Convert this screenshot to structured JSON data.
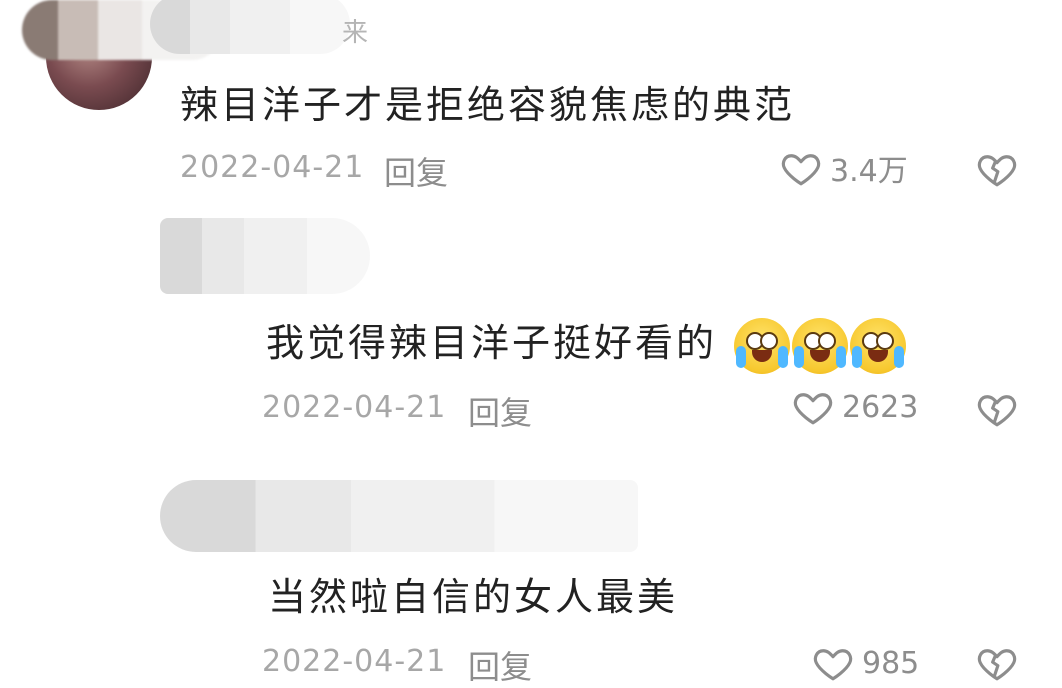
{
  "comments": [
    {
      "name_suffix": "来",
      "text": "辣目洋子才是拒绝容貌焦虑的典范",
      "date": "2022-04-21",
      "reply_label": "回复",
      "likes": "3.4万"
    },
    {
      "name_suffix": "",
      "text": "我觉得辣目洋子挺好看的",
      "emojis": [
        "crying-laughing-emoji",
        "crying-laughing-emoji",
        "crying-laughing-emoji"
      ],
      "date": "2022-04-21",
      "reply_label": "回复",
      "likes": "2623"
    },
    {
      "name_suffix": "",
      "text": "当然啦自信的女人最美",
      "date": "2022-04-21",
      "reply_label": "回复",
      "likes": "985"
    }
  ],
  "icons": {
    "like": "heart-outline-icon",
    "dislike": "broken-heart-icon"
  },
  "colors": {
    "meta_text": "#a7a7a7",
    "icon_stroke": "#8d8d8d"
  }
}
